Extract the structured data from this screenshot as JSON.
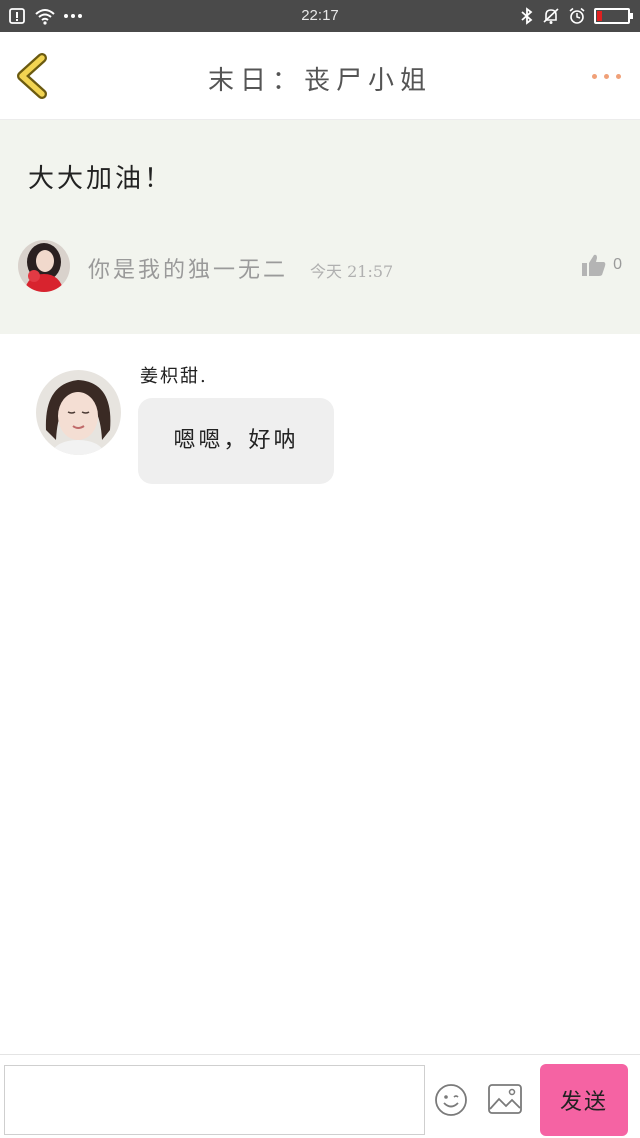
{
  "status_bar": {
    "time": "22:17",
    "battery_level": 0.15,
    "battery_color": "#e02020"
  },
  "header": {
    "title": "末日：丧尸小姐",
    "back_icon": "chevron-left-icon",
    "more_icon": "more-dots-icon",
    "accent_color": "#f0a078"
  },
  "quoted_post": {
    "text": "大大加油！",
    "author": "你是我的独一无二",
    "time": "今天 21:57",
    "like_count": "0",
    "like_icon": "thumbs-up-icon"
  },
  "messages": [
    {
      "sender": "姜枳甜.",
      "text": "嗯嗯，好呐"
    }
  ],
  "input_bar": {
    "placeholder": "",
    "value": "",
    "emoji_icon": "emoji-icon",
    "image_icon": "image-icon",
    "send_label": "发送",
    "send_color": "#f563a3"
  }
}
